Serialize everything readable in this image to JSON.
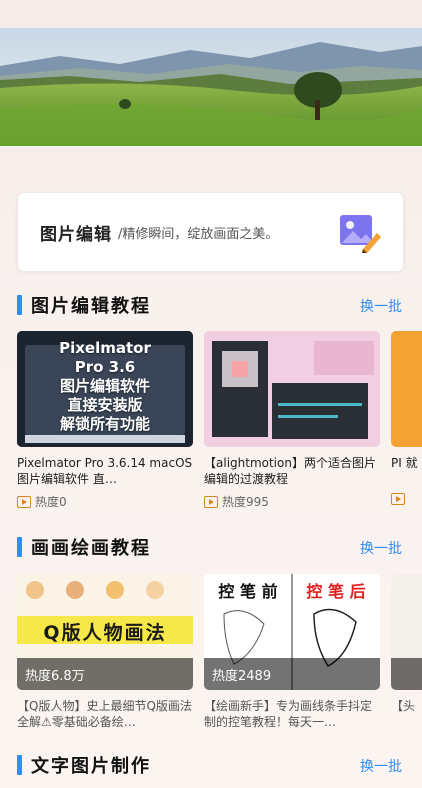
{
  "editor": {
    "title": "图片编辑",
    "subtitle": "/精修瞬间，绽放画面之美。",
    "icon": "image-edit-icon"
  },
  "sections": [
    {
      "title": "图片编辑教程",
      "more": "换一批",
      "cards": [
        {
          "thumb_text": [
            "Pixelmator",
            "Pro 3.6",
            "图片编辑软件",
            "直接安装版",
            "解锁所有功能"
          ],
          "title": "Pixelmator Pro 3.6.14 macOS 图片编辑软件 直…",
          "heat": "热度0"
        },
        {
          "title": "【alightmotion】两个适合图片编辑的过渡教程",
          "heat": "热度995"
        },
        {
          "title": "PI 就",
          "heat": ""
        }
      ]
    },
    {
      "title": "画画绘画教程",
      "more": "换一批",
      "cards": [
        {
          "thumb_text": "Q版人物画法",
          "heat": "热度6.8万",
          "title": "【Q版人物】史上最细节Q版画法全解⚠零基础必备绘…"
        },
        {
          "thumb_left": "控 笔 前",
          "thumb_right": "控 笔 后",
          "heat": "热度2489",
          "title": "【绘画新手】专为画线条手抖定制的控笔教程！每天一…"
        },
        {
          "title": "【头",
          "heat": ""
        }
      ]
    },
    {
      "title": "文字图片制作",
      "more": "换一批"
    }
  ],
  "colors": {
    "accent": "#2f8df5",
    "heat_icon": "#d08a1e"
  }
}
